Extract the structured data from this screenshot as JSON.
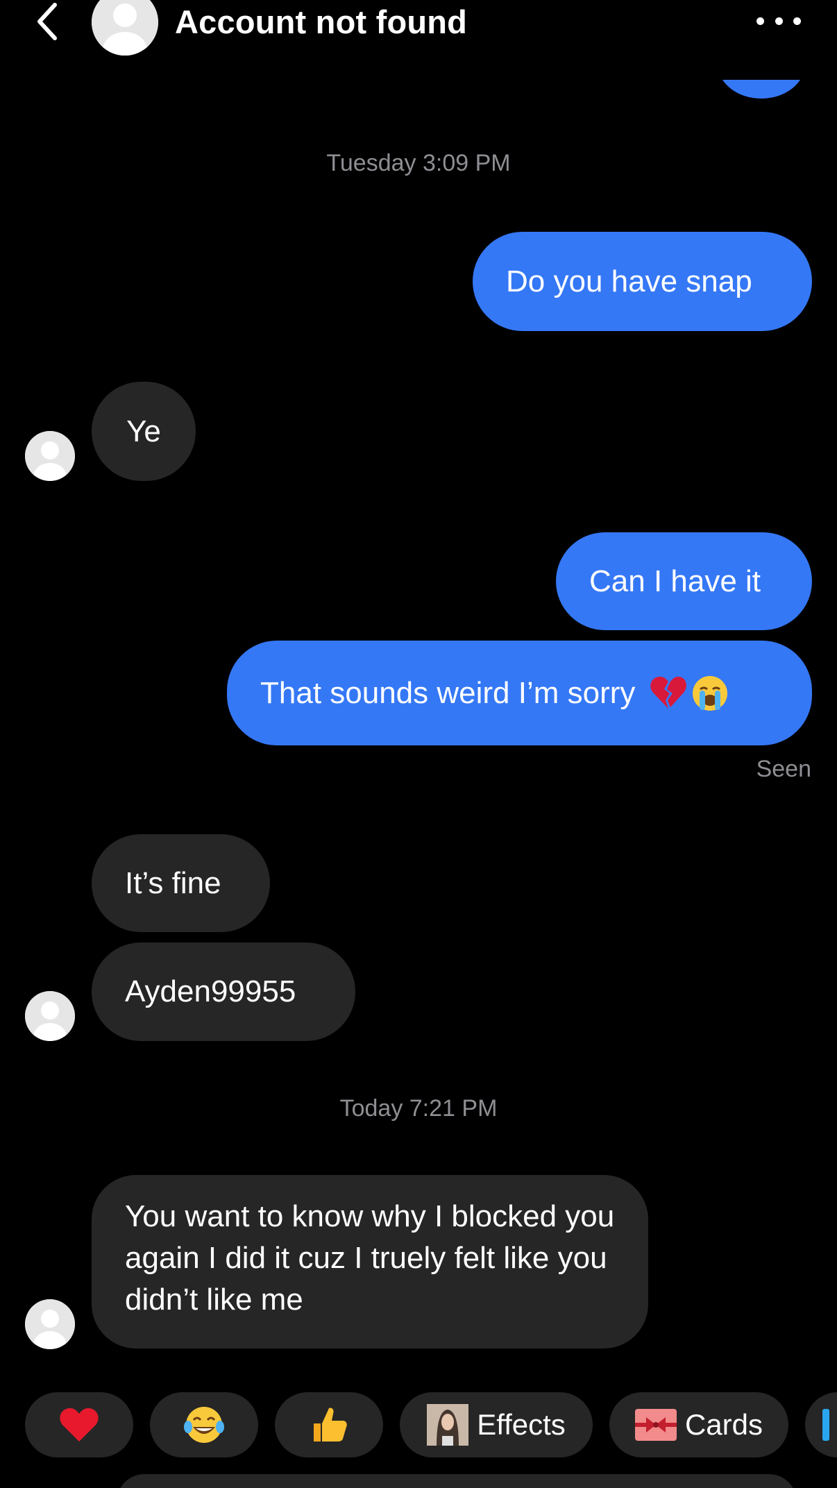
{
  "header": {
    "title": "Account not found",
    "back_icon": "chevron-left-icon",
    "more_icon": "ellipsis-icon"
  },
  "colors": {
    "outgoing_bubble": "#3578f6",
    "incoming_bubble": "#262626",
    "background": "#000000",
    "meta_text": "#8e8e93"
  },
  "conversation": {
    "timestamp_1": "Tuesday 3:09 PM",
    "msg_1": "Do you have snap",
    "msg_2": "Ye",
    "msg_3": "Can I have it",
    "msg_4": "That sounds weird I’m sorry",
    "msg_4_emojis": [
      "broken-heart-icon",
      "loudly-crying-face-icon"
    ],
    "seen": "Seen",
    "msg_5": "It’s fine",
    "msg_6": "Ayden99955",
    "timestamp_2": "Today 7:21 PM",
    "msg_7": "You want to know why I blocked you again I did it cuz I truely felt like you didn’t like me"
  },
  "quick_actions": {
    "heart": "heart-icon",
    "laugh": "tears-of-joy-icon",
    "thumbs": "thumbs-up-icon",
    "effects_label": "Effects",
    "cards_label": "Cards"
  }
}
